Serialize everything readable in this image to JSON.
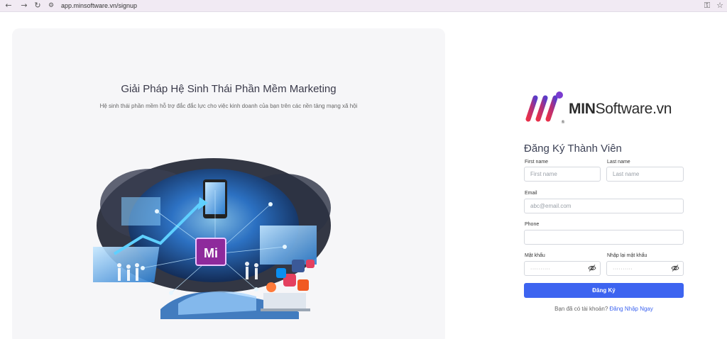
{
  "browser": {
    "back_icon": "←",
    "forward_icon": "→",
    "reload_icon": "↻",
    "site_info_icon": "⚙",
    "url": "app.minsoftware.vn/signup",
    "password_key_icon": "⚿",
    "bookmark_star_icon": "☆"
  },
  "hero": {
    "title": "Giải Pháp Hệ Sinh Thái Phần Mềm Marketing",
    "subtitle": "Hệ sinh thái phần mềm hỗ trợ đắc đắc lực cho việc kinh doanh của bạn trên các nền tảng mạng xã hội",
    "illustration_label": "Mi"
  },
  "logo": {
    "text_bold": "MIN",
    "text_regular": "Software.vn"
  },
  "form": {
    "title": "Đăng Ký Thành Viên",
    "first_name_label": "First name",
    "first_name_placeholder": "First name",
    "last_name_label": "Last name",
    "last_name_placeholder": "Last name",
    "email_label": "Email",
    "email_placeholder": "abc@email.com",
    "phone_label": "Phone",
    "phone_value": "",
    "password_label": "Mật khẩu",
    "password_masked": "··········",
    "confirm_label": "Nhập lại mật khẩu",
    "confirm_masked": "··········",
    "submit_label": "Đăng Ký",
    "have_account_text": "Bạn đã có tài khoản? ",
    "login_link": "Đăng Nhập Ngay"
  }
}
